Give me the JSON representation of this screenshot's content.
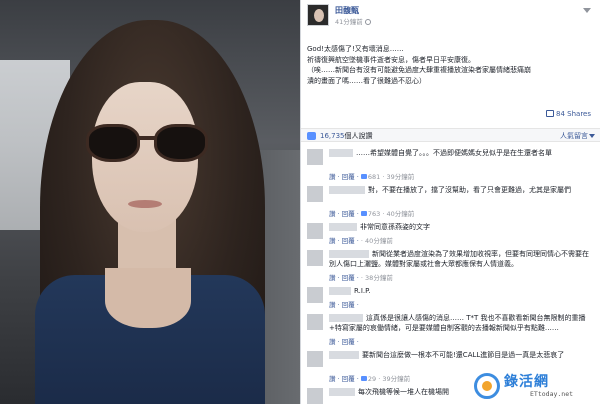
{
  "post": {
    "author": "田馥甄",
    "timestamp": "41分鐘前",
    "lines": [
      "God!太感傷了!又有壞消息……",
      "祈禱復興航空墜機事件逝者安息，傷者早日平安康復。",
      "（唉……新聞台有沒有可能避免過度大肆重複播放渲染者家屬情緒悲痛崩",
      "潰的畫面了嗎……看了很難過不忍心）"
    ],
    "shares": "84 Shares",
    "likes_count": "16,735",
    "likes_suffix": "個人說讚",
    "sort_label": "人氣留言"
  },
  "comments": [
    {
      "text": "……希望媒體自覺了。。。不過即便媽媽女兒似乎是在生還者名單",
      "meta_reply": "讚 · 回覆 ·",
      "meta_likes": "681",
      "meta_time": "39分鐘前",
      "tall": true
    },
    {
      "text": "對，不要在播放了，擋了沒幫助，看了只會更難過，尤其是家屬們",
      "meta_reply": "讚 · 回覆 ·",
      "meta_likes": "763",
      "meta_time": "40分鐘前",
      "tall": true
    },
    {
      "text": "非常同意孫燕姿的文字",
      "meta_reply": "讚 · 回覆 ·",
      "meta_likes": "",
      "meta_time": "40分鐘前",
      "tall": false
    },
    {
      "text": "新聞從業者過度渲染為了效果增加收視率，但要有同理同情心不需要在別人傷口上灑鹽。媒體對家屬或社會大眾都應保有人情道義。",
      "meta_reply": "讚 · 回覆 ·",
      "meta_likes": "",
      "meta_time": "38分鐘前",
      "tall": true
    },
    {
      "text": "R.I.P.",
      "meta_reply": "讚 · 回覆 ·",
      "meta_likes": "",
      "meta_time": "",
      "tall": false
    },
    {
      "text": "這真係是很讓人感傷的消息…… T*T 我也不喜歡看新聞台無限制的重播+特寫家屬的哀働情緒，可是要媒體自制客觀的去播報新聞似乎有點難……",
      "meta_reply": "讚 · 回覆 ·",
      "meta_likes": "",
      "meta_time": "",
      "tall": true
    },
    {
      "text": "要新聞台這麼做一根本不可能!還CALL進節目是過一真是太悲哀了",
      "meta_reply": "讚 · 回覆 ·",
      "meta_likes": "29",
      "meta_time": "39分鐘前",
      "tall": true
    },
    {
      "text": "每次飛機等候一堆人在機場開",
      "meta_reply": "",
      "meta_likes": "",
      "meta_time": "",
      "tall": false
    }
  ],
  "watermark": {
    "title": "錄活網",
    "sub": "ETtoday.net"
  },
  "icons": [
    "globe-icon",
    "chevron-down-icon",
    "share-icon",
    "thumbs-up-icon"
  ],
  "colors": {
    "link": "#3b5998",
    "like": "#5890ff",
    "muted": "#90949c"
  }
}
